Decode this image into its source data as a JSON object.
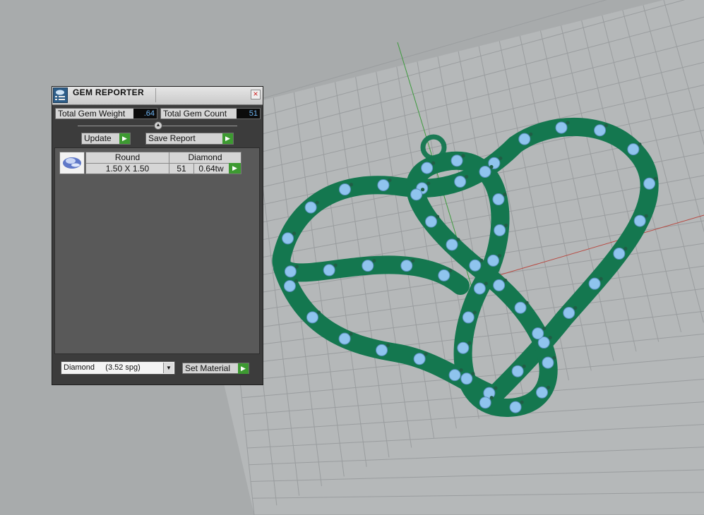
{
  "panel": {
    "title": "GEM REPORTER",
    "total_weight_label": "Total Gem Weight",
    "total_weight_value": ".64",
    "total_count_label": "Total Gem Count",
    "total_count_value": "51",
    "update_label": "Update",
    "save_report_label": "Save Report",
    "close_icon": "close-icon"
  },
  "gem_row": {
    "shape_header": "Round",
    "material_header": "Diamond",
    "size": "1.50 X 1.50",
    "count": "51",
    "weight": "0.64tw"
  },
  "material": {
    "selected": "Diamond     (3.52 spg)",
    "set_label": "Set Material"
  },
  "colors": {
    "metal": "#1f8a61",
    "gem": "#8fc4ee",
    "prong": "#1f5e45",
    "grid_bg": "#b5b8b9",
    "accent_button": "#3d9a31"
  }
}
